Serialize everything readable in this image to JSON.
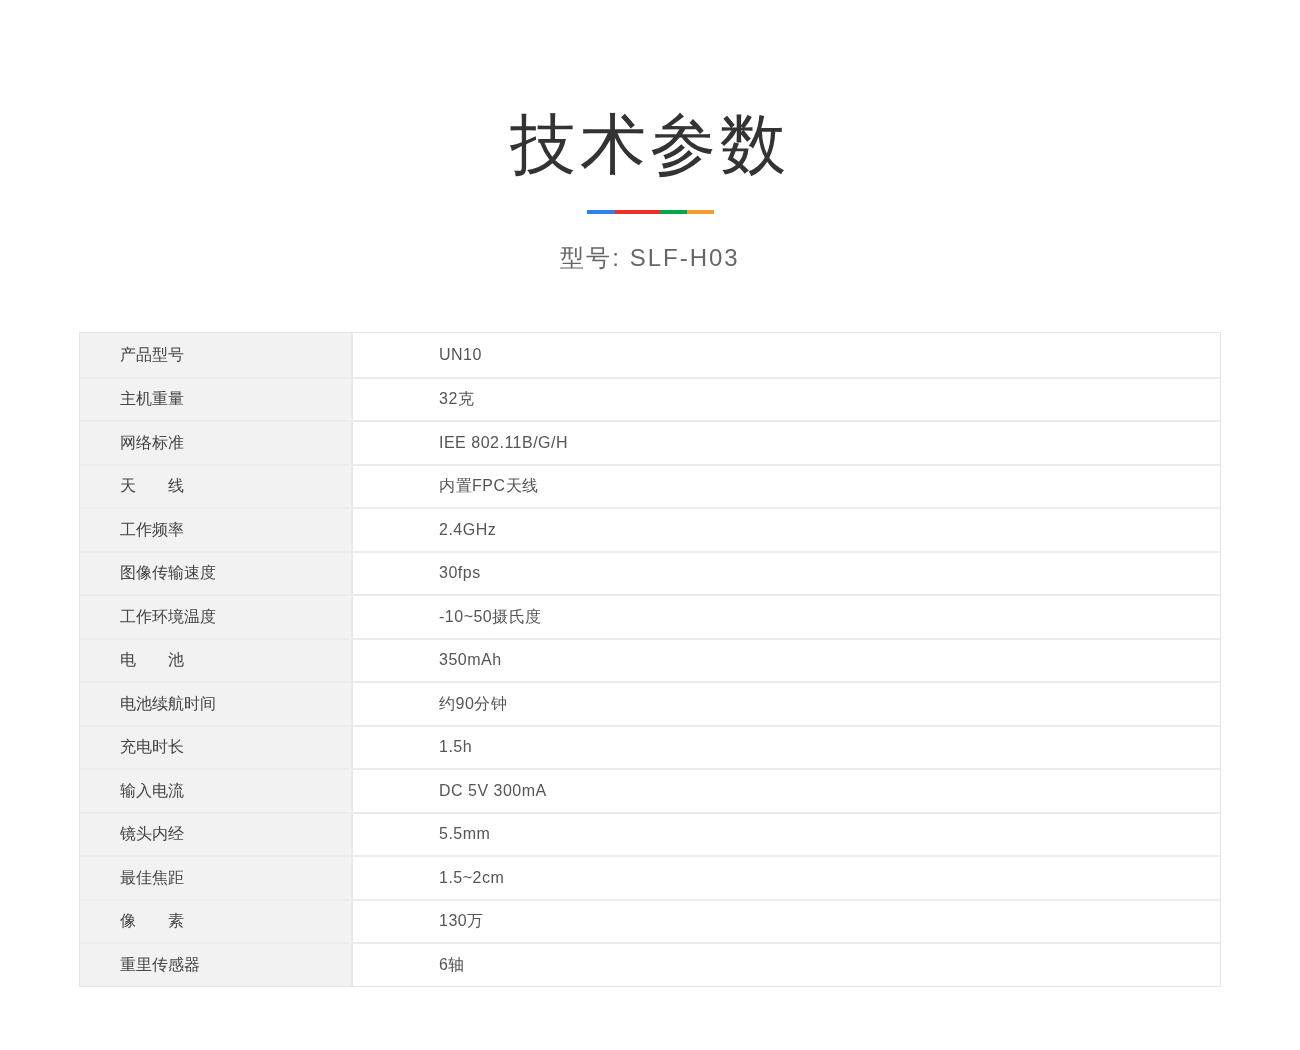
{
  "heading": {
    "title": "技术参数",
    "subtitle": "型号: SLF-H03"
  },
  "specs": [
    {
      "label": "产品型号",
      "value": "UN10"
    },
    {
      "label": "主机重量",
      "value": "32克"
    },
    {
      "label": "网络标准",
      "value": "IEE 802.11B/G/H"
    },
    {
      "label": "天　　线",
      "value": "内置FPC天线"
    },
    {
      "label": "工作频率",
      "value": "2.4GHz"
    },
    {
      "label": "图像传输速度",
      "value": "30fps"
    },
    {
      "label": "工作环境温度",
      "value": "-10~50摄氏度"
    },
    {
      "label": "电　　池",
      "value": "350mAh"
    },
    {
      "label": "电池续航时间",
      "value": "约90分钟"
    },
    {
      "label": "充电时长",
      "value": "1.5h"
    },
    {
      "label": "输入电流",
      "value": "DC 5V 300mA"
    },
    {
      "label": "镜头内经",
      "value": "5.5mm"
    },
    {
      "label": "最佳焦距",
      "value": "1.5~2cm"
    },
    {
      "label": "像　　素",
      "value": "130万"
    },
    {
      "label": "重里传感器",
      "value": "6轴"
    }
  ]
}
